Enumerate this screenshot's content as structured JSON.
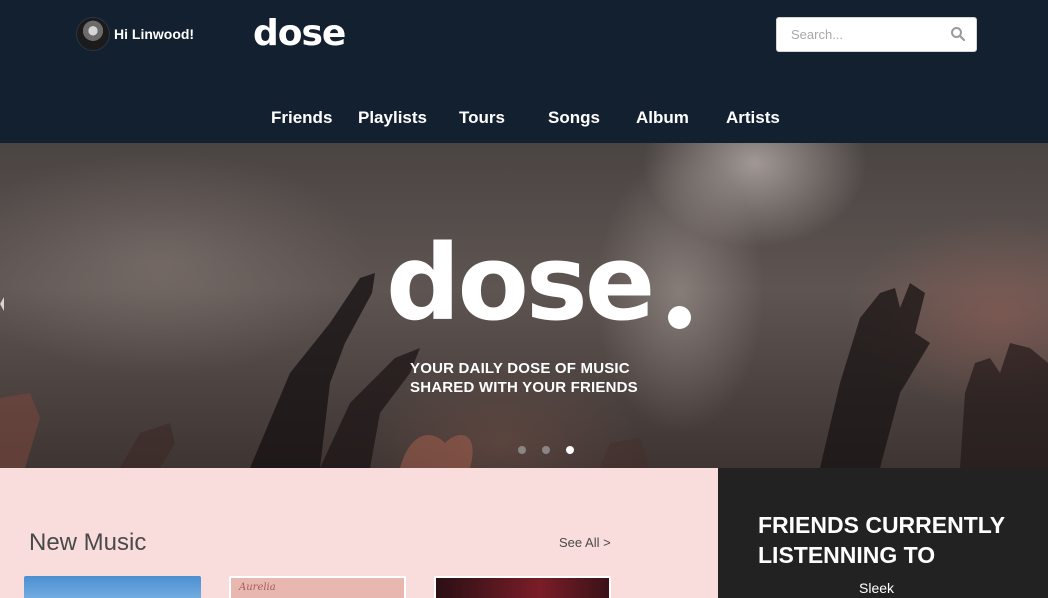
{
  "header": {
    "greeting": "Hi Linwood!",
    "logo": "dose",
    "search": {
      "placeholder": "Search..."
    },
    "nav": [
      "Friends",
      "Playlists",
      "Tours",
      "Songs",
      "Album",
      "Artists"
    ]
  },
  "hero": {
    "logo": "dose",
    "tagline_line1": "YOUR DAILY DOSE OF MUSIC",
    "tagline_line2": "SHARED WITH YOUR FRIENDS",
    "slides": 3,
    "active_slide": 3
  },
  "new_music": {
    "title": "New Music",
    "see_all": "See All >",
    "albums": [
      {
        "cover_text": ""
      },
      {
        "cover_text": "Aurelia"
      },
      {
        "cover_text": ""
      }
    ]
  },
  "friends": {
    "title": "FRIENDS CURRENTLY LISTENNING TO",
    "first_friend": "Sleek"
  },
  "colors": {
    "header_bg": "#13202f",
    "page_bg": "#f9dcdc",
    "panel_bg": "#222222",
    "accent_text": "#ffffff"
  }
}
